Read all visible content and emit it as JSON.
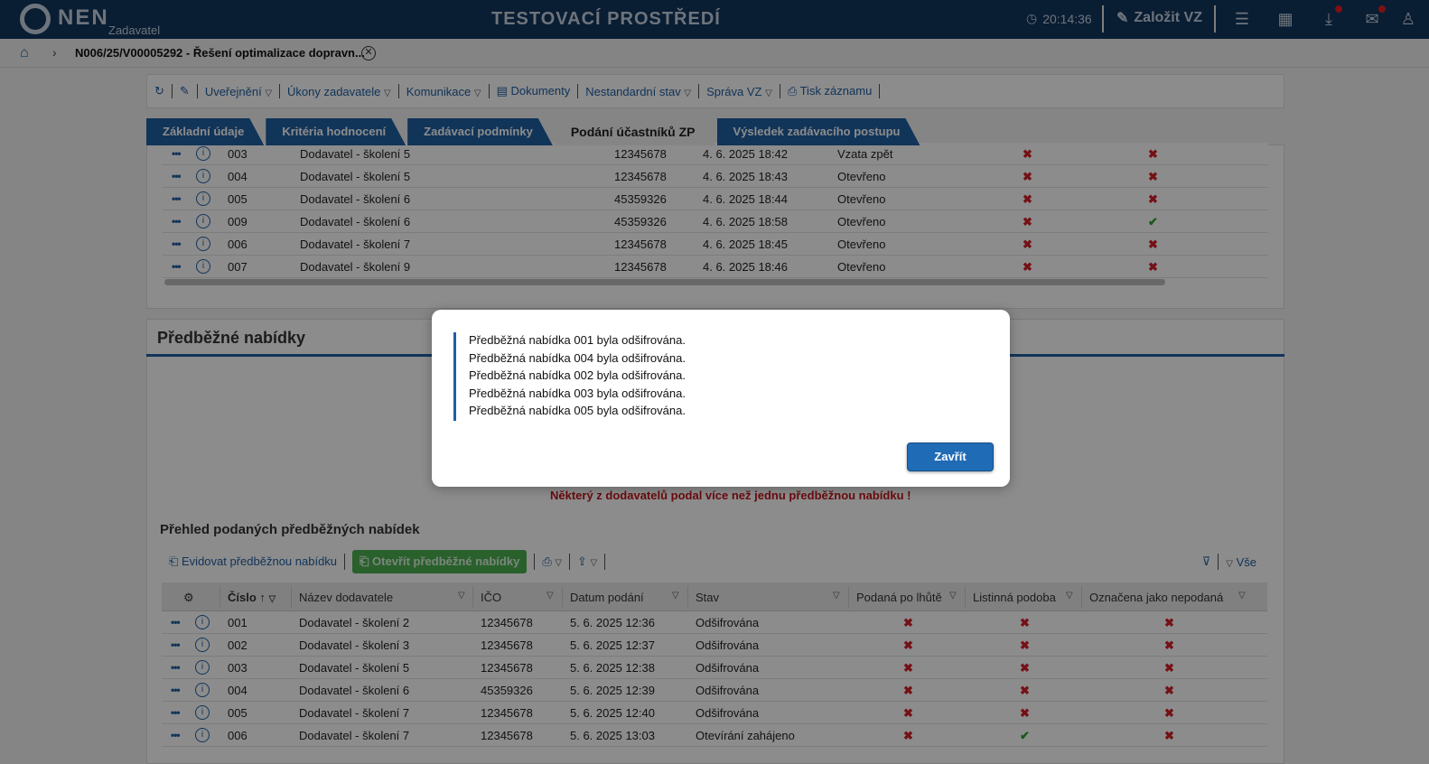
{
  "topbar": {
    "logo": "NEN",
    "logo_sub": "Zadavatel",
    "environment": "TESTOVACÍ PROSTŘEDÍ",
    "clock": "20:14:36",
    "create_label": "Založit VZ",
    "icons": [
      "clock-icon",
      "edit-icon",
      "menu-icon",
      "calendar-icon",
      "download-icon",
      "mail-icon",
      "user-icon"
    ]
  },
  "breadcrumb": {
    "title": "N006/25/V00005292 - Řešení optimalizace dopravn..."
  },
  "toolbar": {
    "items": [
      "Uveřejnění",
      "Úkony zadavatele",
      "Komunikace",
      "Dokumenty",
      "Nestandardní stav",
      "Správa VZ",
      "Tisk záznamu"
    ]
  },
  "tabs": [
    "Základní údaje",
    "Kritéria hodnocení",
    "Zadávací podmínky",
    "Podání účastníků ZP",
    "Výsledek zadávacího postupu"
  ],
  "top_table": {
    "rows": [
      {
        "num": "003",
        "name": "Dodavatel - školení 5",
        "ico": "12345678",
        "date": "4. 6. 2025 18:42",
        "state": "Vzata zpět",
        "c1": "✖",
        "c2": "✖"
      },
      {
        "num": "004",
        "name": "Dodavatel - školení 5",
        "ico": "12345678",
        "date": "4. 6. 2025 18:43",
        "state": "Otevřeno",
        "c1": "✖",
        "c2": "✖"
      },
      {
        "num": "005",
        "name": "Dodavatel - školení 6",
        "ico": "45359326",
        "date": "4. 6. 2025 18:44",
        "state": "Otevřeno",
        "c1": "✖",
        "c2": "✖"
      },
      {
        "num": "009",
        "name": "Dodavatel - školení 6",
        "ico": "45359326",
        "date": "4. 6. 2025 18:58",
        "state": "Otevřeno",
        "c1": "✖",
        "c2": "✔"
      },
      {
        "num": "006",
        "name": "Dodavatel - školení 7",
        "ico": "12345678",
        "date": "4. 6. 2025 18:45",
        "state": "Otevřeno",
        "c1": "✖",
        "c2": "✖"
      },
      {
        "num": "007",
        "name": "Dodavatel - školení 9",
        "ico": "12345678",
        "date": "4. 6. 2025 18:46",
        "state": "Otevřeno",
        "c1": "✖",
        "c2": "✖"
      }
    ]
  },
  "section": {
    "title": "Předběžné nabídky",
    "warning": "Některý z dodavatelů podal více než jednu předběžnou nabídku !",
    "subtitle": "Přehled podaných předběžných nabídek",
    "btn_register": "Evidovat předběžnou nabídku",
    "btn_open": "Otevřít předběžné nabídky",
    "filter_label": "Vše"
  },
  "bottom_table": {
    "headers": [
      "Číslo",
      "Název dodavatele",
      "IČO",
      "Datum podání",
      "Stav",
      "Podaná po lhůtě",
      "Listinná podoba",
      "Označena jako nepodaná"
    ],
    "rows": [
      {
        "num": "001",
        "name": "Dodavatel - školení 2",
        "ico": "12345678",
        "date": "5. 6. 2025 12:36",
        "state": "Odšifrována",
        "c1": "✖",
        "c2": "✖",
        "c3": "✖"
      },
      {
        "num": "002",
        "name": "Dodavatel - školení 3",
        "ico": "12345678",
        "date": "5. 6. 2025 12:37",
        "state": "Odšifrována",
        "c1": "✖",
        "c2": "✖",
        "c3": "✖"
      },
      {
        "num": "003",
        "name": "Dodavatel - školení 5",
        "ico": "12345678",
        "date": "5. 6. 2025 12:38",
        "state": "Odšifrována",
        "c1": "✖",
        "c2": "✖",
        "c3": "✖"
      },
      {
        "num": "004",
        "name": "Dodavatel - školení 6",
        "ico": "45359326",
        "date": "5. 6. 2025 12:39",
        "state": "Odšifrována",
        "c1": "✖",
        "c2": "✖",
        "c3": "✖"
      },
      {
        "num": "005",
        "name": "Dodavatel - školení 7",
        "ico": "12345678",
        "date": "5. 6. 2025 12:40",
        "state": "Odšifrována",
        "c1": "✖",
        "c2": "✖",
        "c3": "✖"
      },
      {
        "num": "006",
        "name": "Dodavatel - školení 7",
        "ico": "12345678",
        "date": "5. 6. 2025 13:03",
        "state": "Otevírání zahájeno",
        "c1": "✖",
        "c2": "✔",
        "c3": "✖"
      }
    ]
  },
  "modal": {
    "messages": [
      "Předběžná nabídka 001 byla odšifrována.",
      "Předběžná nabídka 004 byla odšifrována.",
      "Předběžná nabídka 002 byla odšifrována.",
      "Předběžná nabídka 003 byla odšifrována.",
      "Předběžná nabídka 005 byla odšifrována."
    ],
    "close_label": "Zavřít"
  },
  "colors": {
    "brand": "#12355d",
    "accent": "#1f5fa3",
    "error": "#d41f2a",
    "success": "#2aa12a"
  }
}
